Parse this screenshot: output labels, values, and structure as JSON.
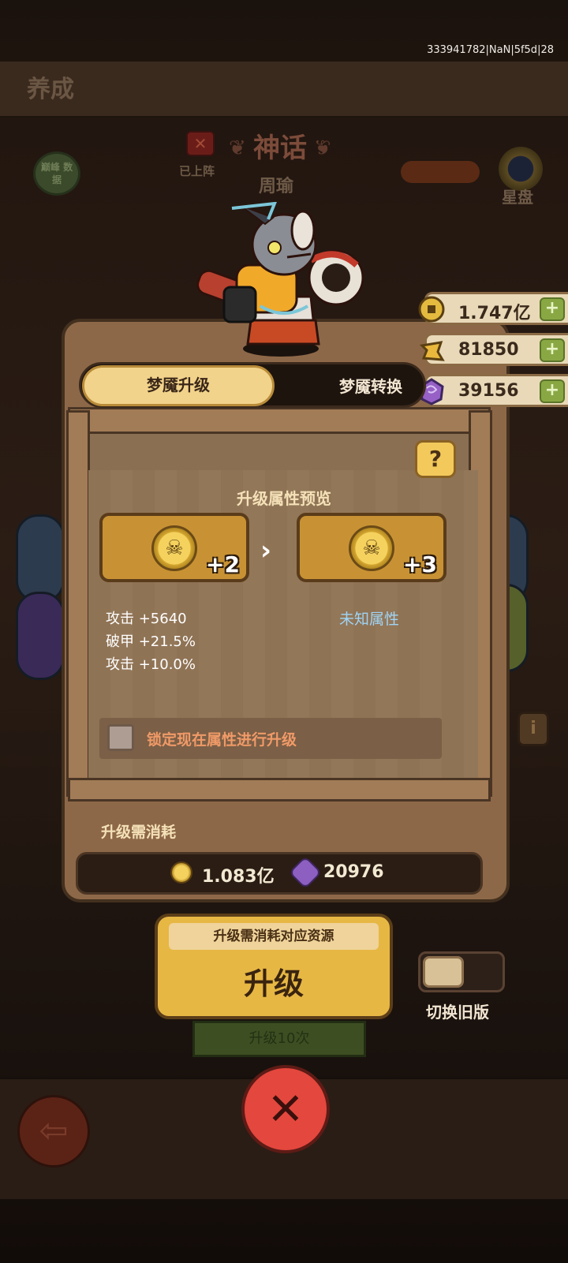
{
  "debug_id": "333941782|NaN|5f5d|28",
  "page_title": "养成",
  "side_button_label": "巅峰\n数据",
  "deployed_label": "已上阵",
  "hero": {
    "rarity": "神话",
    "name": "周瑜"
  },
  "star_disk_label": "星盘",
  "resources": [
    {
      "icon": "copper-coin-icon",
      "value": "1.747亿"
    },
    {
      "icon": "gold-ingot-icon",
      "value": "81850"
    },
    {
      "icon": "purple-gem-icon",
      "value": "39156"
    }
  ],
  "tabs": {
    "active": "梦魇升级",
    "inactive": "梦魇转换"
  },
  "help_label": "?",
  "preview": {
    "title": "升级属性预览",
    "current_level": "+2",
    "next_level": "+3",
    "stats": [
      "攻击 +5640",
      "破甲 +21.5%",
      "攻击 +10.0%"
    ],
    "unknown_label": "未知属性"
  },
  "lock_label": "锁定现在属性进行升级",
  "cost": {
    "title": "升级需消耗",
    "coin_value": "1.083亿",
    "gem_value": "20976"
  },
  "upgrade": {
    "sub_label": "升级需消耗对应资源",
    "main_label": "升级",
    "ten_label": "升级10次"
  },
  "toggle_label": "切换旧版",
  "info_label": "i",
  "colors": {
    "accent_gold": "#e7b744",
    "close_red": "#e4473d",
    "unknown_blue": "#9fd4f5",
    "lock_orange": "#f09a68"
  }
}
